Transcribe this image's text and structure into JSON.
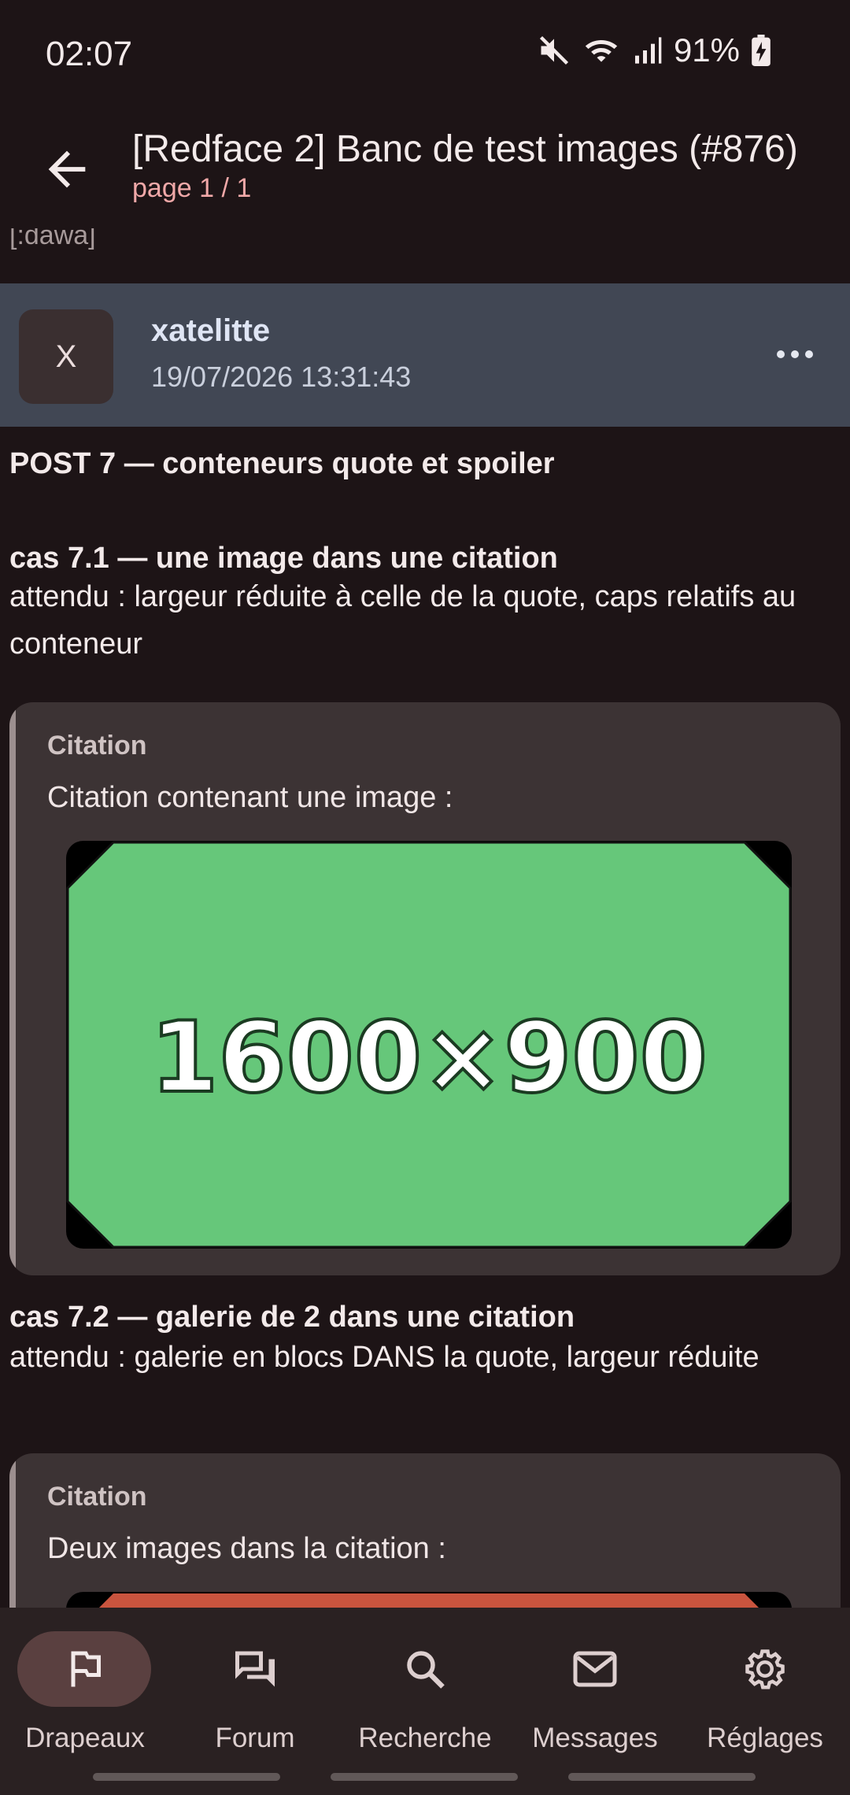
{
  "status_bar": {
    "time": "02:07",
    "battery": "91%"
  },
  "app_bar": {
    "title": "[Redface 2] Banc de test images (#876)",
    "subtitle": "page 1 / 1"
  },
  "clipped_text": "[:dawa]",
  "post": {
    "avatar_letter": "X",
    "author": "xatelitte",
    "date": "19/07/2026 13:31:43",
    "heading": "POST 7 — conteneurs quote et spoiler",
    "case1": {
      "title": "cas 7.1 — une image dans une citation",
      "expected": "attendu : largeur réduite à celle de la quote, caps relatifs au conteneur",
      "quote_label": "Citation",
      "quote_text": "Citation contenant une image :",
      "image_label": "1600×900",
      "image_color": "#66c77a"
    },
    "case2": {
      "title": "cas 7.2 — galerie de 2 dans une citation",
      "expected": "attendu : galerie en blocs DANS la quote, largeur réduite",
      "quote_label": "Citation",
      "quote_text": "Deux images dans la citation :",
      "image_color": "#c9543e"
    }
  },
  "nav": {
    "items": [
      {
        "label": "Drapeaux",
        "icon": "flag-icon",
        "active": true
      },
      {
        "label": "Forum",
        "icon": "forum-icon",
        "active": false
      },
      {
        "label": "Recherche",
        "icon": "search-icon",
        "active": false
      },
      {
        "label": "Messages",
        "icon": "mail-icon",
        "active": false
      },
      {
        "label": "Réglages",
        "icon": "gear-icon",
        "active": false
      }
    ]
  }
}
